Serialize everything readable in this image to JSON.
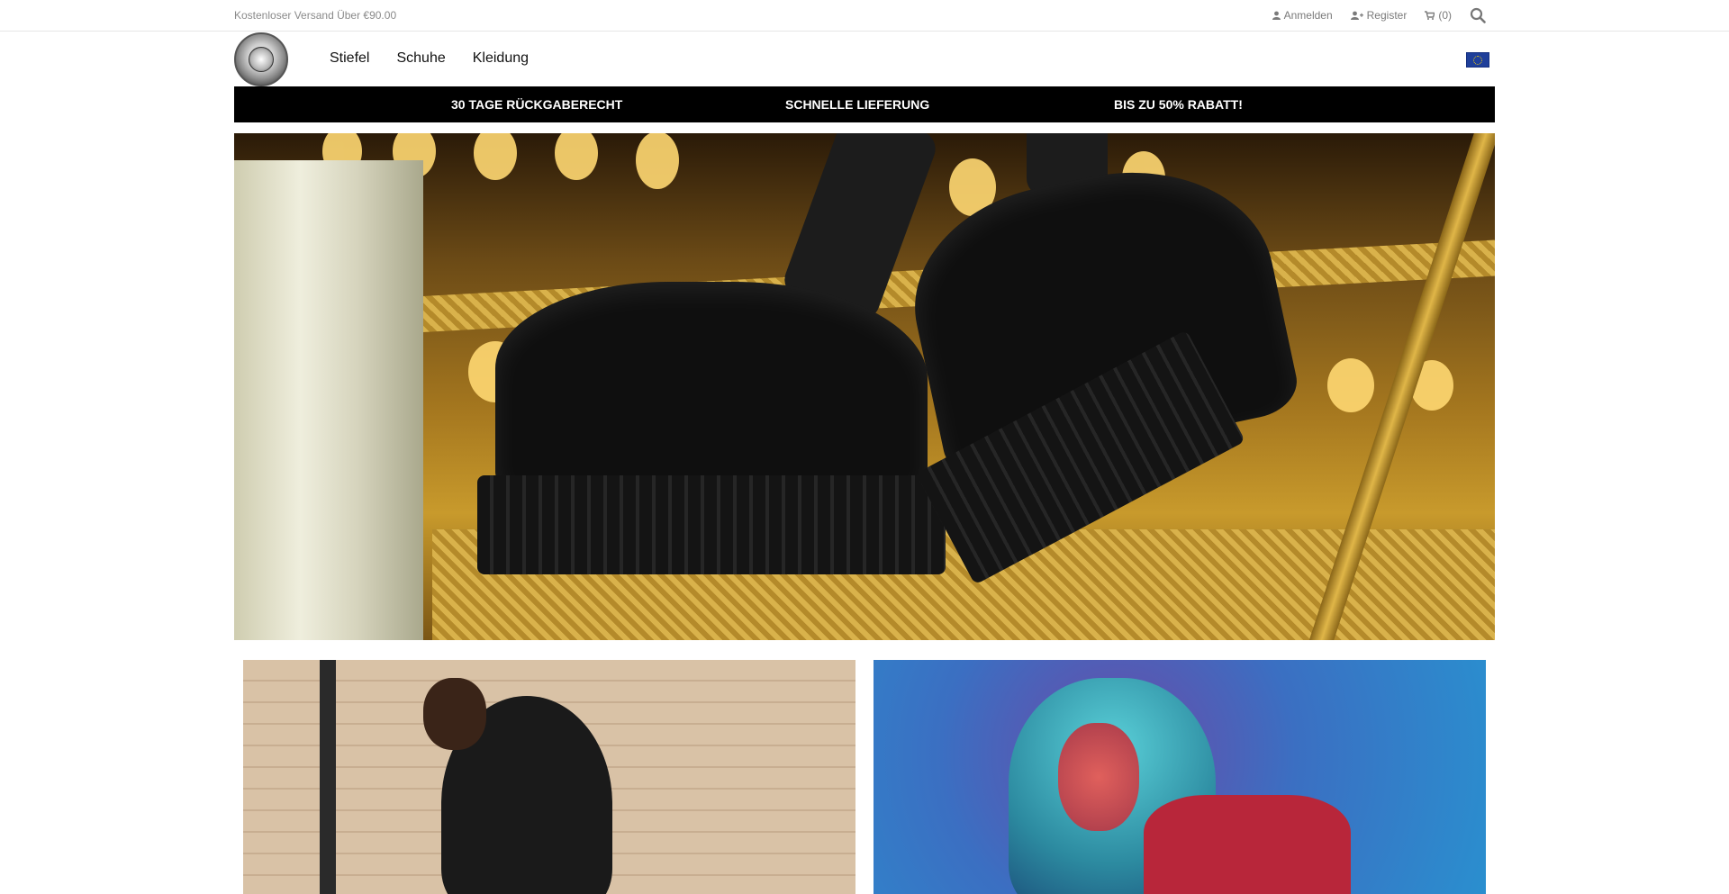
{
  "topbar": {
    "shipping_text": "Kostenloser Versand Über €90.00",
    "login_label": "Anmelden",
    "register_label": "Register",
    "cart_label": "(0)"
  },
  "nav": {
    "items": [
      "Stiefel",
      "Schuhe",
      "Kleidung"
    ]
  },
  "promo": {
    "items": [
      "30 TAGE RÜCKGABERECHT",
      "SCHNELLE LIEFERUNG",
      "BIS ZU 50% RABATT!"
    ]
  },
  "icons": {
    "user": "user-icon",
    "register": "user-plus-icon",
    "cart": "cart-icon",
    "search": "search-icon",
    "flag": "eu-flag-icon"
  },
  "colors": {
    "promo_bg": "#000000",
    "promo_text": "#ffffff",
    "muted_text": "#7a7a7a"
  }
}
